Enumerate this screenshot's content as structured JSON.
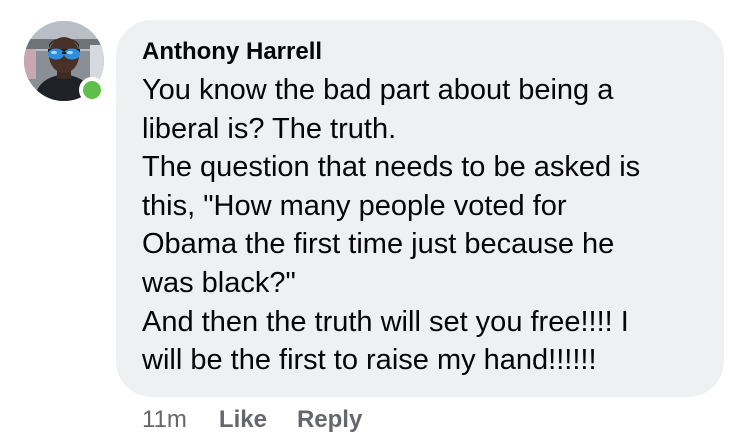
{
  "comment": {
    "author": "Anthony Harrell",
    "avatar_icon": "user-profile-photo",
    "online_status_color": "#5ebf4a",
    "lines": [
      "You know the bad part about being a",
      "liberal is? The truth.",
      "The question that needs to be asked is",
      "this, \"How many people voted for",
      "Obama the first time just because he",
      "was black?\"",
      "And then the truth will set you free!!!! I",
      "will be the first to raise my hand!!!!!!"
    ],
    "timestamp": "11m",
    "like_label": "Like",
    "reply_label": "Reply"
  }
}
